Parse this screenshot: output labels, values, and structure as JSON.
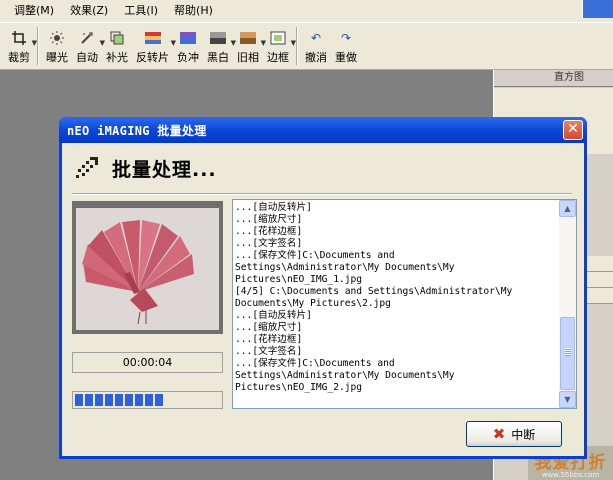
{
  "menu": [
    "调整(M)",
    "效果(Z)",
    "工具(I)",
    "帮助(H)"
  ],
  "toolbar": [
    {
      "label": "裁剪",
      "icon": "crop-icon",
      "arrow": true
    },
    {
      "label": "曝光",
      "icon": "exposure-icon",
      "arrow": false
    },
    {
      "label": "自动",
      "icon": "auto-wand-icon",
      "arrow": true
    },
    {
      "label": "补光",
      "icon": "fill-light-icon",
      "arrow": false
    },
    {
      "label": "反转片",
      "icon": "reversal-film-icon",
      "arrow": true
    },
    {
      "label": "负冲",
      "icon": "cross-process-icon",
      "arrow": false
    },
    {
      "label": "黑白",
      "icon": "black-white-icon",
      "arrow": true
    },
    {
      "label": "旧相",
      "icon": "old-photo-icon",
      "arrow": true
    },
    {
      "label": "边框",
      "icon": "frame-icon",
      "arrow": true
    },
    {
      "label": "撤消",
      "icon": "undo-icon",
      "arrow": false
    },
    {
      "label": "重做",
      "icon": "redo-icon",
      "arrow": false
    }
  ],
  "right_panel": {
    "title": "直方图"
  },
  "dialog": {
    "title": "nEO iMAGING 批量处理",
    "heading": "批量处理...",
    "timer": "00:00:04",
    "progress_fraction": 0.67,
    "log_lines": [
      "...[自动反转片]",
      "...[缩放尺寸]",
      "...[花样边框]",
      "...[文字签名]",
      "...[保存文件]C:\\Documents and",
      "Settings\\Administrator\\My Documents\\My",
      "Pictures\\nEO_IMG_1.jpg",
      "[4/5] C:\\Documents and Settings\\Administrator\\My",
      "Documents\\My Pictures\\2.jpg",
      "...[自动反转片]",
      "...[缩放尺寸]",
      "...[花样边框]",
      "...[文字签名]",
      "...[保存文件]C:\\Documents and",
      "Settings\\Administrator\\My Documents\\My",
      "Pictures\\nEO_IMG_2.jpg"
    ],
    "stop_label": "中断"
  },
  "watermark": {
    "main": "我爱打折",
    "sub": "www.55bbs.com"
  }
}
